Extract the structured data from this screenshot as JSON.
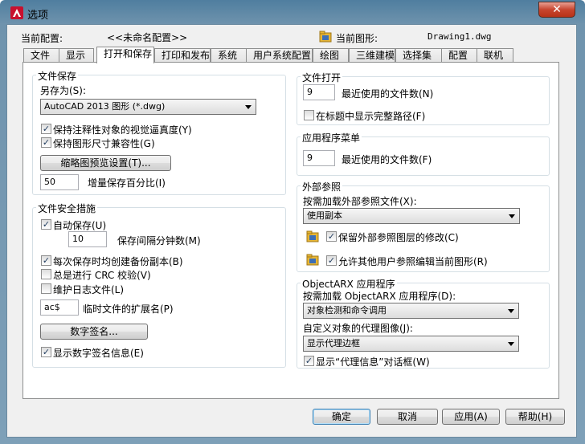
{
  "window": {
    "title": "选项",
    "close": "✕"
  },
  "profile": {
    "label": "当前配置:",
    "value": "<<未命名配置>>",
    "drawing_label": "当前图形:",
    "drawing_value": "Drawing1.dwg"
  },
  "tabs": [
    "文件",
    "显示",
    "打开和保存",
    "打印和发布",
    "系统",
    "用户系统配置",
    "绘图",
    "三维建模",
    "选择集",
    "配置",
    "联机"
  ],
  "file_save": {
    "title": "文件保存",
    "saveas_label": "另存为(S):",
    "saveas_value": "AutoCAD 2013 图形 (*.dwg)",
    "maintain_visual": "保持注释性对象的视觉逼真度(Y)",
    "maintain_drawing": "保持图形尺寸兼容性(G)",
    "thumbnail_button": "缩略图预览设置(T)...",
    "incremental_value": "50",
    "incremental_label": "增量保存百分比(I)"
  },
  "file_safety": {
    "title": "文件安全措施",
    "autosave": "自动保存(U)",
    "minutes_value": "10",
    "minutes_label": "保存间隔分钟数(M)",
    "backup": "每次保存时均创建备份副本(B)",
    "crc": "总是进行 CRC 校验(V)",
    "logfile": "维护日志文件(L)",
    "ext_value": "ac$",
    "ext_label": "临时文件的扩展名(P)",
    "digital_sig_button": "数字签名...",
    "show_sig": "显示数字签名信息(E)"
  },
  "file_open": {
    "title": "文件打开",
    "count_value": "9",
    "count_label": "最近使用的文件数(N)",
    "fullpath": "在标题中显示完整路径(F)"
  },
  "app_menu": {
    "title": "应用程序菜单",
    "count_value": "9",
    "count_label": "最近使用的文件数(F)"
  },
  "xref": {
    "title": "外部参照",
    "demand_label": "按需加载外部参照文件(X):",
    "demand_value": "使用副本",
    "retain": "保留外部参照图层的修改(C)",
    "allow_edit": "允许其他用户参照编辑当前图形(R)"
  },
  "objectarx": {
    "title": "ObjectARX 应用程序",
    "load_label": "按需加载 ObjectARX 应用程序(D):",
    "load_value": "对象检测和命令调用",
    "proxy_label": "自定义对象的代理图像(J):",
    "proxy_value": "显示代理边框",
    "proxy_info": "显示“代理信息”对话框(W)"
  },
  "buttons": {
    "ok": "确定",
    "cancel": "取消",
    "apply": "应用(A)",
    "help": "帮助(H)"
  },
  "check_mark": "✓"
}
